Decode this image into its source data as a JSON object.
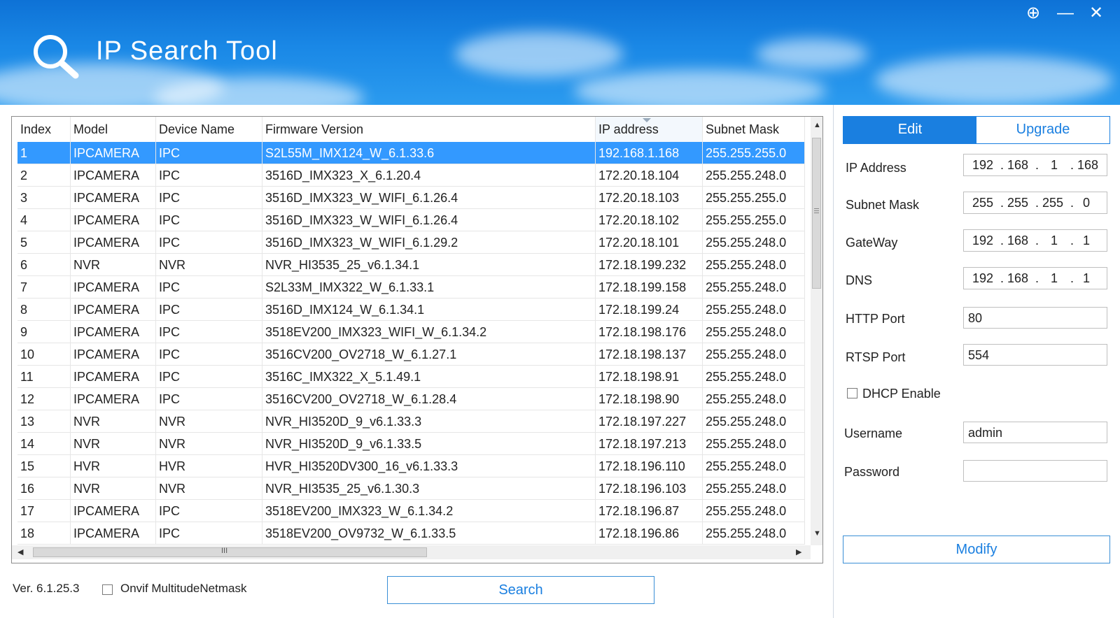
{
  "window": {
    "title": "IP Search Tool",
    "buttons": [
      "⊕",
      "—",
      "✕"
    ]
  },
  "table": {
    "columns": [
      "Index",
      "Model",
      "Device Name",
      "Firmware Version",
      "IP address",
      "Subnet Mask"
    ],
    "rows": [
      [
        "1",
        "IPCAMERA",
        "IPC",
        "S2L55M_IMX124_W_6.1.33.6",
        "192.168.1.168",
        "255.255.255.0"
      ],
      [
        "2",
        "IPCAMERA",
        "IPC",
        "3516D_IMX323_X_6.1.20.4",
        "172.20.18.104",
        "255.255.248.0"
      ],
      [
        "3",
        "IPCAMERA",
        "IPC",
        "3516D_IMX323_W_WIFI_6.1.26.4",
        "172.20.18.103",
        "255.255.255.0"
      ],
      [
        "4",
        "IPCAMERA",
        "IPC",
        "3516D_IMX323_W_WIFI_6.1.26.4",
        "172.20.18.102",
        "255.255.255.0"
      ],
      [
        "5",
        "IPCAMERA",
        "IPC",
        "3516D_IMX323_W_WIFI_6.1.29.2",
        "172.20.18.101",
        "255.255.248.0"
      ],
      [
        "6",
        "NVR",
        "NVR",
        "NVR_HI3535_25_v6.1.34.1",
        "172.18.199.232",
        "255.255.248.0"
      ],
      [
        "7",
        "IPCAMERA",
        "IPC",
        "S2L33M_IMX322_W_6.1.33.1",
        "172.18.199.158",
        "255.255.248.0"
      ],
      [
        "8",
        "IPCAMERA",
        "IPC",
        "3516D_IMX124_W_6.1.34.1",
        "172.18.199.24",
        "255.255.248.0"
      ],
      [
        "9",
        "IPCAMERA",
        "IPC",
        "3518EV200_IMX323_WIFI_W_6.1.34.2",
        "172.18.198.176",
        "255.255.248.0"
      ],
      [
        "10",
        "IPCAMERA",
        "IPC",
        "3516CV200_OV2718_W_6.1.27.1",
        "172.18.198.137",
        "255.255.248.0"
      ],
      [
        "11",
        "IPCAMERA",
        "IPC",
        "3516C_IMX322_X_5.1.49.1",
        "172.18.198.91",
        "255.255.248.0"
      ],
      [
        "12",
        "IPCAMERA",
        "IPC",
        "3516CV200_OV2718_W_6.1.28.4",
        "172.18.198.90",
        "255.255.248.0"
      ],
      [
        "13",
        "NVR",
        "NVR",
        "NVR_HI3520D_9_v6.1.33.3",
        "172.18.197.227",
        "255.255.248.0"
      ],
      [
        "14",
        "NVR",
        "NVR",
        "NVR_HI3520D_9_v6.1.33.5",
        "172.18.197.213",
        "255.255.248.0"
      ],
      [
        "15",
        "HVR",
        "HVR",
        "HVR_HI3520DV300_16_v6.1.33.3",
        "172.18.196.110",
        "255.255.248.0"
      ],
      [
        "16",
        "NVR",
        "NVR",
        "NVR_HI3535_25_v6.1.30.3",
        "172.18.196.103",
        "255.255.248.0"
      ],
      [
        "17",
        "IPCAMERA",
        "IPC",
        "3518EV200_IMX323_W_6.1.34.2",
        "172.18.196.87",
        "255.255.248.0"
      ],
      [
        "18",
        "IPCAMERA",
        "IPC",
        "3518EV200_OV9732_W_6.1.33.5",
        "172.18.196.86",
        "255.255.248.0"
      ]
    ],
    "selected_row": 1,
    "scroll_h_label": "III"
  },
  "footer": {
    "version": "Ver. 6.1.25.3",
    "onvif_label": "Onvif MultitudeNetmask",
    "search_label": "Search"
  },
  "panel": {
    "tabs": [
      "Edit",
      "Upgrade"
    ],
    "active_tab": "Edit",
    "ip_label": "IP Address",
    "ip_value": [
      "192",
      "168",
      "1",
      "168"
    ],
    "mask_label": "Subnet Mask",
    "mask_value": [
      "255",
      "255",
      "255",
      "0"
    ],
    "gateway_label": "GateWay",
    "gateway_value": [
      "192",
      "168",
      "1",
      "1"
    ],
    "dns_label": "DNS",
    "dns_value": [
      "192",
      "168",
      "1",
      "1"
    ],
    "http_label": "HTTP Port",
    "http_value": "80",
    "rtsp_label": "RTSP Port",
    "rtsp_value": "554",
    "dhcp_label": "DHCP Enable",
    "username_label": "Username",
    "username_value": "admin",
    "password_label": "Password",
    "password_value": "",
    "modify_label": "Modify"
  },
  "colors": {
    "header_blue": "#1a88e6",
    "selection": "#3399ff",
    "accent": "#1a7fe0"
  }
}
